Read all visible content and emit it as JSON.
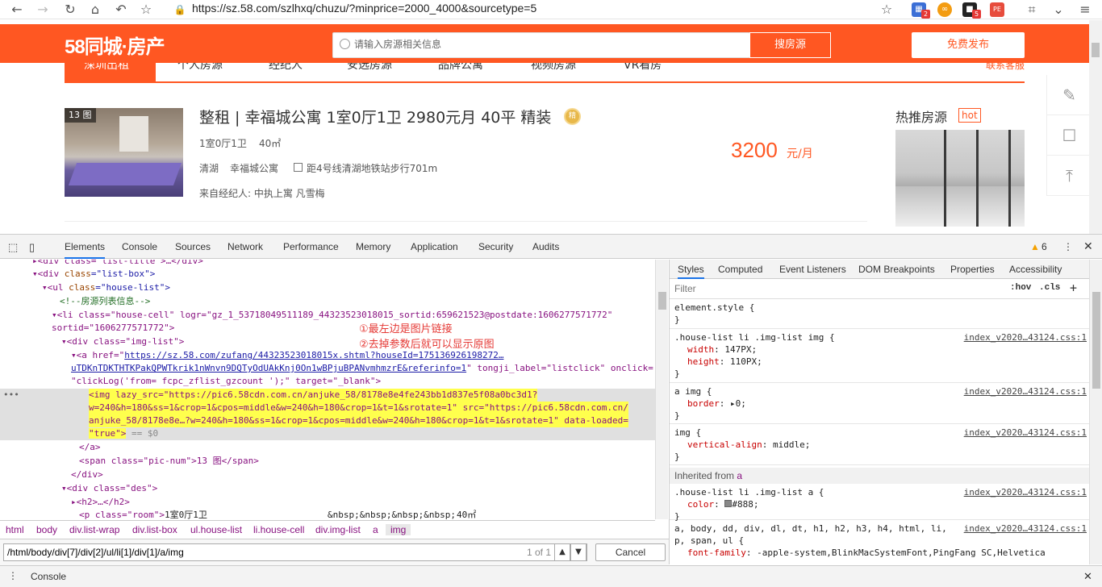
{
  "browser": {
    "url": "https://sz.58.com/szlhxq/chuzu/?minprice=2000_4000&sourcetype=5",
    "ext_badges": [
      "2",
      "5"
    ],
    "ext_ms_label": "PE"
  },
  "site": {
    "logo": "58同城·房产",
    "search_placeholder": "请输入房源相关信息",
    "search_button": "搜房源",
    "publish_button": "免费发布",
    "tabs": [
      "深圳出租",
      "个人房源",
      "经纪人",
      "安选房源",
      "品牌公寓",
      "视频房源",
      "VR看房"
    ],
    "contact": "联系客服",
    "listing": {
      "pic_count": "13 图",
      "title": "整租 | 幸福城公寓 1室0厅1卫 2980元月 40平 精装",
      "medal": "精",
      "room": "1室0厅1卫",
      "area": "40㎡",
      "district": "清湖",
      "community": "幸福城公寓",
      "subway": "距4号线清湖地铁站步行701m",
      "agent": "来自经纪人: 中执上寓 凡雪梅",
      "price": "3200",
      "price_unit": "元/月"
    },
    "hot_title": "热推房源",
    "hot_badge": "hot"
  },
  "devtools": {
    "tabs": [
      "Elements",
      "Console",
      "Sources",
      "Network",
      "Performance",
      "Memory",
      "Application",
      "Security",
      "Audits"
    ],
    "warnings": "6",
    "elements": {
      "l0": "<div class=\"list-title\">…</div>",
      "l1a": "<div ",
      "l1b": "class",
      "l1c": "=\"list-box\">",
      "l2a": "<ul ",
      "l2b": "class",
      "l2c": "=\"house-list\">",
      "l3": "<!--房源列表信息-->",
      "l4": "<li class=\"house-cell\" logr=\"gz_1_53718049511189_44323523018015_sortid:659621523@postdate:1606277571772\"",
      "l5": "sortid=\"1606277571772\">",
      "l6": "<div class=\"img-list\">",
      "l7a": "<a href=\"",
      "l7b": "https://sz.58.com/zufang/44323523018015x.shtml?houseId=175136926198272…",
      "l8a": "uTDKnTDKTHTKPakQPWTkrik1nWnvn9DQTyOdUAkKnj0On1wBPjuBPANvmhmzrE&referinfo=1",
      "l8b": "\" tongji_label=\"listclick\" onclick=",
      "l9": "\"clickLog('from= fcpc_zflist_gzcount ');\" target=\"_blank\">",
      "sel1": "<img lazy_src=\"https://pic6.58cdn.com.cn/anjuke_58/8178e8e4fe243bb1d837e5f08a0bc3d1?",
      "sel2": "w=240&h=180&ss=1&crop=1&cpos=middle&w=240&h=180&crop=1&t=1&srotate=1\" src=\"https://pic6.58cdn.com.cn/",
      "sel3": "anjuke_58/8178e8e…?w=240&h=180&ss=1&crop=1&cpos=middle&w=240&h=180&crop=1&t=1&srotate=1\" data-loaded=",
      "sel4": "\"true\">",
      "sel4b": " == $0",
      "l10": "</a>",
      "l11": "<span class=\"pic-num\">13 图</span>",
      "l12": "</div>",
      "l13": "<div class=\"des\">",
      "l14": "<h2>…</h2>",
      "l15": "<p class=\"room\">",
      "l15b": "1室0厅1卫",
      "l15c": "&nbsp;&nbsp;&nbsp;&nbsp;",
      "l15d": "40㎡"
    },
    "annotations": [
      "①最左边是图片链接",
      "②去掉参数后就可以显示原图"
    ],
    "styles_tabs": [
      "Styles",
      "Computed",
      "Event Listeners",
      "DOM Breakpoints",
      "Properties",
      "Accessibility"
    ],
    "filter_placeholder": "Filter",
    "hov": ":hov",
    "cls": ".cls",
    "rules": {
      "r0": "element.style {",
      "r1_sel": ".house-list li .img-list img {",
      "r1_src": "index_v2020…43124.css:1",
      "r1_p1": "width",
      "r1_v1": "147PX;",
      "r1_p2": "height",
      "r1_v2": "110PX;",
      "r2_sel": "a img {",
      "r2_src": "index_v2020…43124.css:1",
      "r2_p1": "border",
      "r2_v1": "0;",
      "r3_sel": "img {",
      "r3_src": "index_v2020…43124.css:1",
      "r3_p1": "vertical-align",
      "r3_v1": "middle;",
      "inherited": "Inherited from",
      "inherited_tag": "a",
      "r4_sel": ".house-list li .img-list a {",
      "r4_src": "index_v2020…43124.css:1",
      "r4_p1": "color",
      "r4_v1": "#888;",
      "r5_sel1": "a, body, dd, div, dl, dt, h1, h2, h3, h4, html, li,",
      "r5_sel2": "p, span, ul {",
      "r5_src": "index_v2020…43124.css:1",
      "r5_p1": "font-family",
      "r5_v1": "-apple-system,BlinkMacSystemFont,PingFang SC,Helvetica",
      "close": "}"
    },
    "breadcrumb": [
      "html",
      "body",
      "div.list-wrap",
      "div.list-box",
      "ul.house-list",
      "li.house-cell",
      "div.img-list",
      "a",
      "img"
    ],
    "find_value": "/html/body/div[7]/div[2]/ul/li[1]/div[1]/a/img",
    "find_count": "1 of 1",
    "cancel": "Cancel",
    "console_drawer": "Console"
  }
}
